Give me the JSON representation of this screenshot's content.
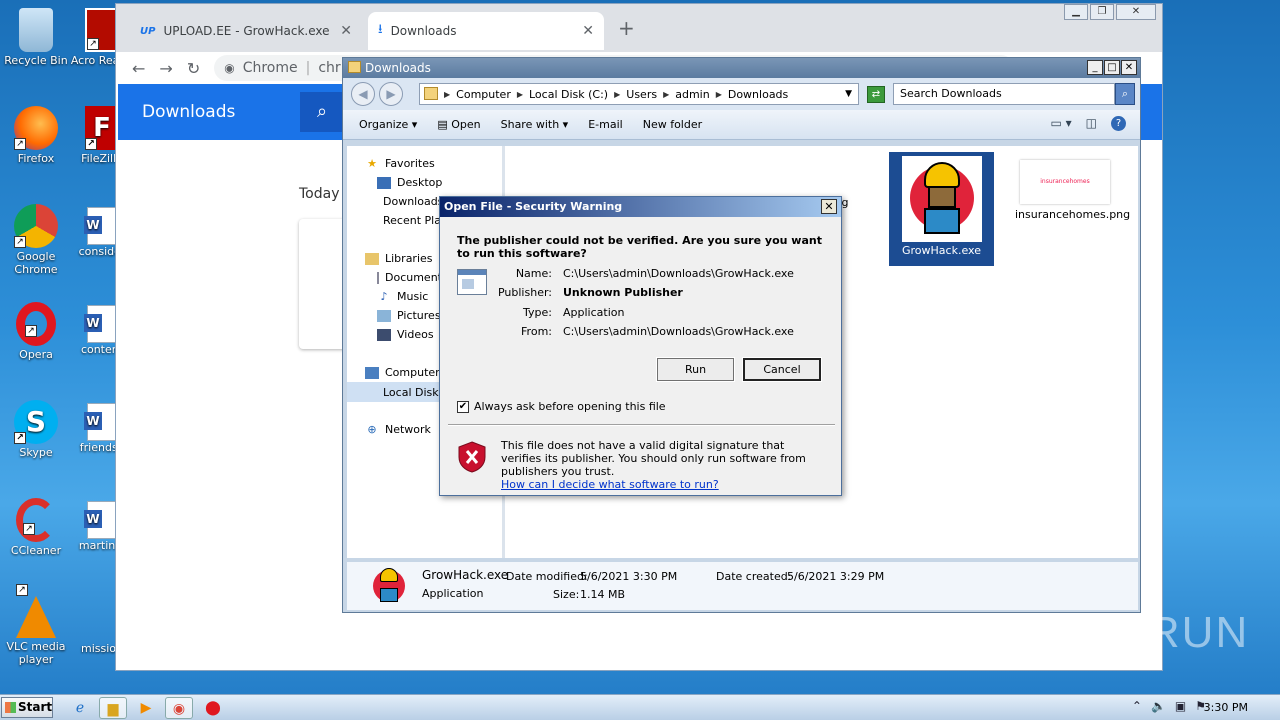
{
  "desktop": {
    "icons": [
      {
        "label": "Recycle Bin"
      },
      {
        "label": "Firefox"
      },
      {
        "label": "Google Chrome"
      },
      {
        "label": "Opera"
      },
      {
        "label": "Skype"
      },
      {
        "label": "CCleaner"
      },
      {
        "label": "VLC media player"
      },
      {
        "label": "Acro Reade"
      },
      {
        "label": "FileZilla"
      },
      {
        "label": "consider"
      },
      {
        "label": "content"
      },
      {
        "label": "friendsv"
      },
      {
        "label": "martinle"
      },
      {
        "label": "mission"
      }
    ]
  },
  "chrome": {
    "tabs": [
      {
        "label": "UPLOAD.EE - GrowHack.exe - Down",
        "favicon": "UP"
      },
      {
        "label": "Downloads"
      }
    ],
    "new_tab": "+",
    "address_prefix": "Chrome",
    "address_text": "chr",
    "downloads_title": "Downloads",
    "today_label": "Today"
  },
  "explorer": {
    "title": "Downloads",
    "breadcrumbs": [
      "Computer",
      "Local Disk (C:)",
      "Users",
      "admin",
      "Downloads"
    ],
    "search_placeholder": "Search Downloads",
    "toolbar": {
      "organize": "Organize",
      "open": "Open",
      "share": "Share with",
      "email": "E-mail",
      "new_folder": "New folder"
    },
    "nav": {
      "favorites": "Favorites",
      "desktop": "Desktop",
      "downloads": "Downloads",
      "recent": "Recent Places",
      "libraries": "Libraries",
      "documents": "Documents",
      "music": "Music",
      "pictures": "Pictures",
      "videos": "Videos",
      "computer": "Computer",
      "local_disk": "Local Disk (C:)",
      "network": "Network"
    },
    "files": [
      {
        "name": "GrowHack.exe",
        "selected": true
      },
      {
        "name": "insurancehomes.png",
        "selected": false
      },
      {
        "name": "g"
      }
    ],
    "thumb_text": "insurancehomes",
    "details": {
      "name": "GrowHack.exe",
      "type": "Application",
      "modified_label": "Date modified:",
      "modified": "5/6/2021 3:30 PM",
      "created_label": "Date created:",
      "created": "5/6/2021 3:29 PM",
      "size_label": "Size:",
      "size": "1.14 MB"
    }
  },
  "dialog": {
    "title": "Open File - Security Warning",
    "question": "The publisher could not be verified.  Are you sure you want to run this software?",
    "fields": [
      {
        "label": "Name:",
        "value": "C:\\Users\\admin\\Downloads\\GrowHack.exe"
      },
      {
        "label": "Publisher:",
        "value": "Unknown Publisher"
      },
      {
        "label": "Type:",
        "value": "Application"
      },
      {
        "label": "From:",
        "value": "C:\\Users\\admin\\Downloads\\GrowHack.exe"
      }
    ],
    "run": "Run",
    "cancel": "Cancel",
    "checkbox_label": "Always ask before opening this file",
    "checkbox_checked": true,
    "warning_text": "This file does not have a valid digital signature that verifies its publisher.  You should only run software from publishers you trust.",
    "warning_link": "How can I decide what software to run?"
  },
  "taskbar": {
    "start": "Start",
    "clock": "3:30 PM"
  },
  "watermark": "ANY RUN",
  "colors": {
    "accent": "#1a73e8",
    "dialog_title": "#0a246a",
    "selection": "#1c4c92"
  }
}
